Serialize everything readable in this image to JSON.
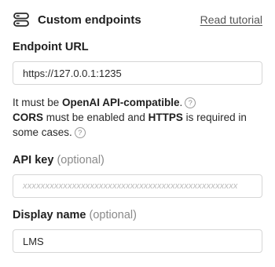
{
  "header": {
    "title": "Custom endpoints",
    "link": "Read tutorial"
  },
  "endpoint": {
    "label": "Endpoint URL",
    "value": "https://127.0.0.1:1235"
  },
  "help": {
    "line1_prefix": "It must be ",
    "line1_bold": "OpenAI API-compatible",
    "line1_suffix": ".",
    "line2_bold1": "CORS",
    "line2_mid": " must be enabled and ",
    "line2_bold2": "HTTPS",
    "line2_suffix": " is required in some cases.",
    "help_icon": "?"
  },
  "api_key": {
    "label": "API key",
    "optional": "(optional)",
    "placeholder": "xxxxxxxxxxxxxxxxxxxxxxxxxxxxxxxxxxxxxxxxxxxxxxxx"
  },
  "display_name": {
    "label": "Display name",
    "optional": "(optional)",
    "value": "LMS"
  }
}
